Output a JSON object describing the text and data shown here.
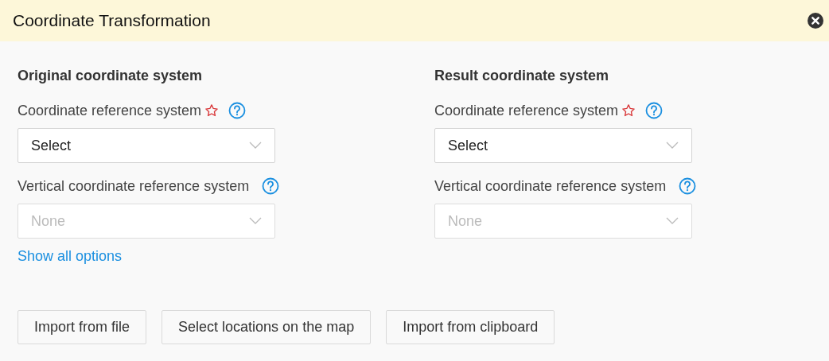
{
  "window": {
    "title": "Coordinate Transformation"
  },
  "columns": [
    {
      "heading": "Original coordinate system",
      "fields": [
        {
          "label": "Coordinate reference system",
          "required": true,
          "value": "Select",
          "disabled": false
        },
        {
          "label": "Vertical coordinate reference system",
          "required": false,
          "value": "None",
          "disabled": true
        }
      ],
      "link": "Show all options"
    },
    {
      "heading": "Result coordinate system",
      "fields": [
        {
          "label": "Coordinate reference system",
          "required": true,
          "value": "Select",
          "disabled": false
        },
        {
          "label": "Vertical coordinate reference system",
          "required": false,
          "value": "None",
          "disabled": true
        }
      ]
    }
  ],
  "buttons": [
    "Import from file",
    "Select locations on the map",
    "Import from clipboard"
  ]
}
